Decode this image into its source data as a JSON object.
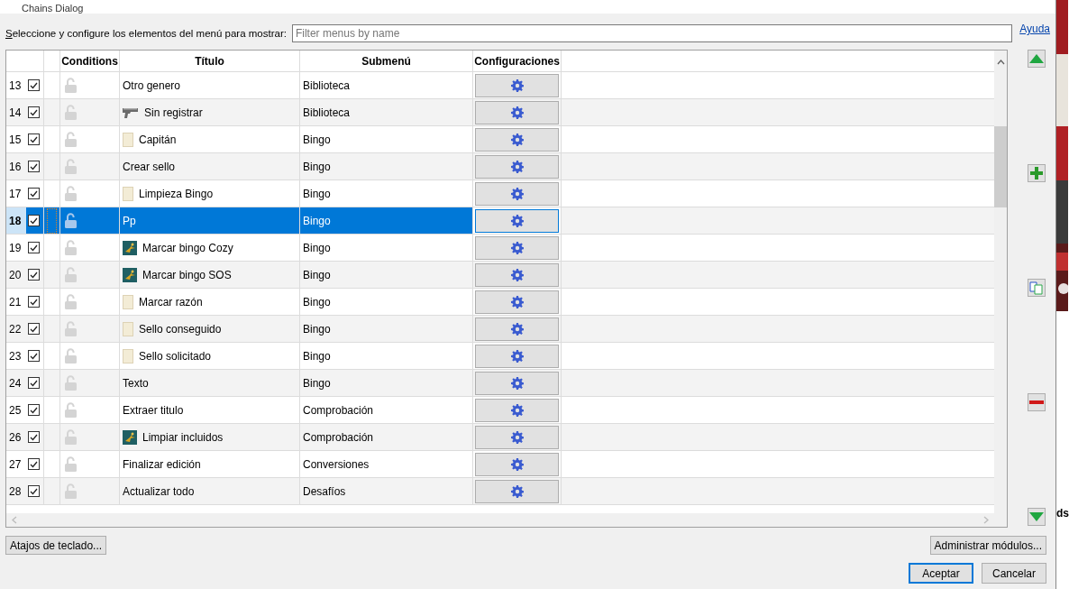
{
  "window": {
    "title": "Chains Dialog"
  },
  "instruction": "Seleccione y configure los elementos del menú para mostrar:",
  "filter": {
    "placeholder": "Filter menus by name"
  },
  "help_link": "Ayuda",
  "table": {
    "columns": [
      "",
      "",
      "Conditions",
      "Título",
      "Submenú",
      "Configuraciones"
    ],
    "rows": [
      {
        "number": "13",
        "checked": true,
        "selected": false,
        "kind": "plain",
        "title": "Otro genero",
        "submenu": "Biblioteca"
      },
      {
        "number": "14",
        "checked": true,
        "selected": false,
        "kind": "tool",
        "title": "Sin registrar",
        "submenu": "Biblioteca"
      },
      {
        "number": "15",
        "checked": true,
        "selected": false,
        "kind": "note",
        "title": "Capitán",
        "submenu": "Bingo"
      },
      {
        "number": "16",
        "checked": true,
        "selected": false,
        "kind": "plain",
        "title": "Crear sello",
        "submenu": "Bingo"
      },
      {
        "number": "17",
        "checked": true,
        "selected": false,
        "kind": "note",
        "title": "Limpieza Bingo",
        "submenu": "Bingo"
      },
      {
        "number": "18",
        "checked": true,
        "selected": true,
        "kind": "plain",
        "title": "Pp",
        "submenu": "Bingo"
      },
      {
        "number": "19",
        "checked": true,
        "selected": false,
        "kind": "emblem",
        "title": "Marcar bingo Cozy",
        "submenu": "Bingo"
      },
      {
        "number": "20",
        "checked": true,
        "selected": false,
        "kind": "emblem",
        "title": "Marcar bingo SOS",
        "submenu": "Bingo"
      },
      {
        "number": "21",
        "checked": true,
        "selected": false,
        "kind": "note",
        "title": "Marcar razón",
        "submenu": "Bingo"
      },
      {
        "number": "22",
        "checked": true,
        "selected": false,
        "kind": "note",
        "title": "Sello conseguido",
        "submenu": "Bingo"
      },
      {
        "number": "23",
        "checked": true,
        "selected": false,
        "kind": "note",
        "title": "Sello solicitado",
        "submenu": "Bingo"
      },
      {
        "number": "24",
        "checked": true,
        "selected": false,
        "kind": "plain",
        "title": "Texto",
        "submenu": "Bingo"
      },
      {
        "number": "25",
        "checked": true,
        "selected": false,
        "kind": "plain",
        "title": "Extraer titulo",
        "submenu": "Comprobación"
      },
      {
        "number": "26",
        "checked": true,
        "selected": false,
        "kind": "emblem",
        "title": "Limpiar incluidos",
        "submenu": "Comprobación"
      },
      {
        "number": "27",
        "checked": true,
        "selected": false,
        "kind": "plain",
        "title": "Finalizar edición",
        "submenu": "Conversiones"
      },
      {
        "number": "28",
        "checked": true,
        "selected": false,
        "kind": "plain",
        "title": "Actualizar todo",
        "submenu": "Desafíos"
      }
    ]
  },
  "buttons": {
    "shortcuts": "Atajos de teclado...",
    "plugins": "Administrar módulos...",
    "ok": "Aceptar",
    "cancel": "Cancelar"
  },
  "background_app_text": "ds"
}
